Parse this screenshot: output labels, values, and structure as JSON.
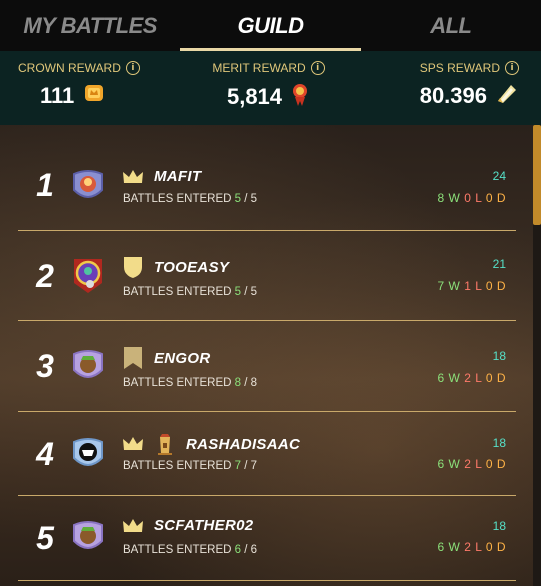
{
  "tabs": [
    {
      "label": "MY BATTLES"
    },
    {
      "label": "GUILD"
    },
    {
      "label": "ALL"
    }
  ],
  "active_tab": "GUILD",
  "rewards": {
    "crown": {
      "label": "CROWN REWARD",
      "value": "111",
      "icon": "crown-token-icon"
    },
    "merit": {
      "label": "MERIT REWARD",
      "value": "5,814",
      "icon": "merit-token-icon"
    },
    "sps": {
      "label": "SPS REWARD",
      "value": "80.396",
      "icon": "sps-token-icon"
    }
  },
  "battles_label": "BATTLES ENTERED",
  "players": [
    {
      "rank": "1",
      "name": "MAFIT",
      "badges": [
        "crown-icon"
      ],
      "entered": "5",
      "total": "5",
      "points": "24",
      "w": "8",
      "l": "0",
      "d": "0"
    },
    {
      "rank": "2",
      "name": "TOOEASY",
      "badges": [
        "shield-icon"
      ],
      "entered": "5",
      "total": "5",
      "points": "21",
      "w": "7",
      "l": "1",
      "d": "0"
    },
    {
      "rank": "3",
      "name": "ENGOR",
      "badges": [
        "flag-icon"
      ],
      "entered": "8",
      "total": "8",
      "points": "18",
      "w": "6",
      "l": "2",
      "d": "0"
    },
    {
      "rank": "4",
      "name": "RASHADISAAC",
      "badges": [
        "crown-icon",
        "tower-icon"
      ],
      "entered": "7",
      "total": "7",
      "points": "18",
      "w": "6",
      "l": "2",
      "d": "0"
    },
    {
      "rank": "5",
      "name": "SCFATHER02",
      "badges": [
        "crown-icon"
      ],
      "entered": "6",
      "total": "6",
      "points": "18",
      "w": "6",
      "l": "2",
      "d": "0"
    }
  ],
  "colors": {
    "accent_gold": "#e0c77a",
    "win": "#8be07a",
    "loss": "#ff7a6a",
    "draw": "#ffb347",
    "points": "#56e0c8"
  }
}
